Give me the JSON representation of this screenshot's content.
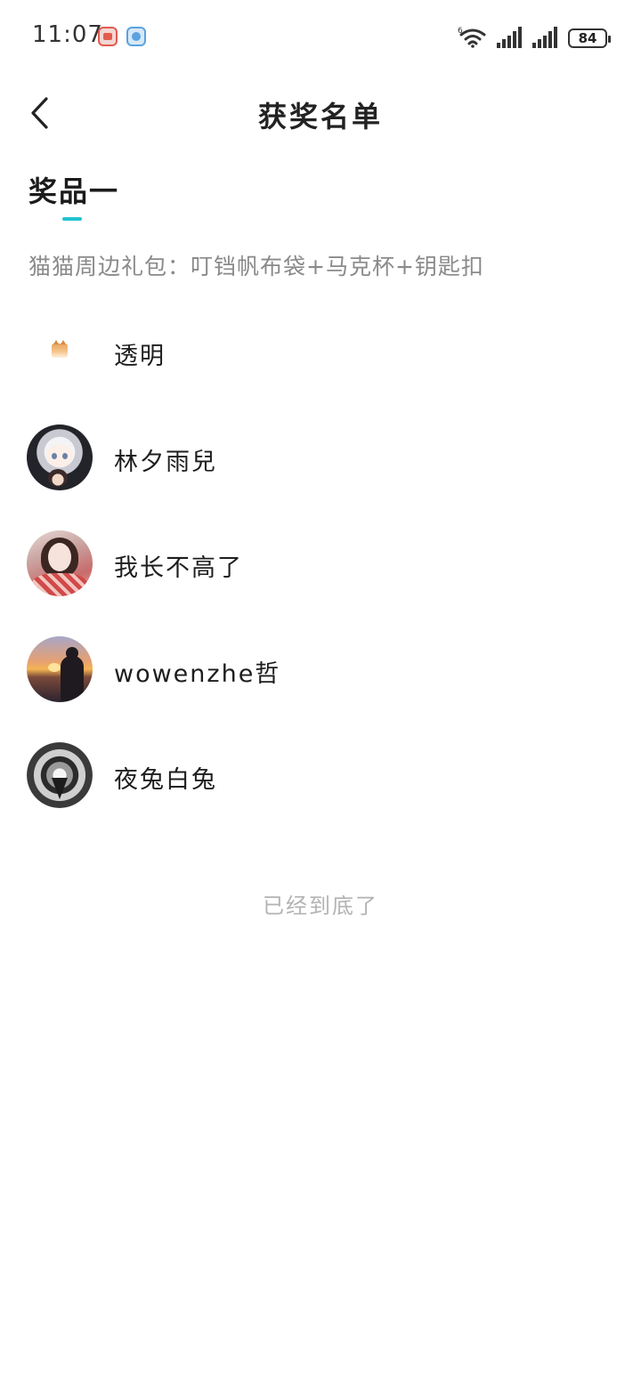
{
  "status_bar": {
    "time": "11:07",
    "app_icons": [
      "red-app-icon",
      "blue-chat-app-icon"
    ],
    "network_label": "6",
    "battery_level": "84"
  },
  "nav": {
    "back_icon": "chevron-left-icon",
    "title": "获奖名单"
  },
  "prize": {
    "tab_label": "奖品一",
    "description": "猫猫周边礼包：叮铛帆布袋+马克杯+钥匙扣"
  },
  "winners": [
    {
      "name": "透明"
    },
    {
      "name": "林夕雨兒"
    },
    {
      "name": "我长不高了"
    },
    {
      "name": "wowenzhe哲"
    },
    {
      "name": "夜兔白兔"
    }
  ],
  "footer": {
    "end_text": "已经到底了"
  },
  "colors": {
    "accent": "#22c3cf",
    "text_primary": "#1e1e1e",
    "text_secondary": "#8a8a8a",
    "text_muted": "#b3b3b3"
  }
}
